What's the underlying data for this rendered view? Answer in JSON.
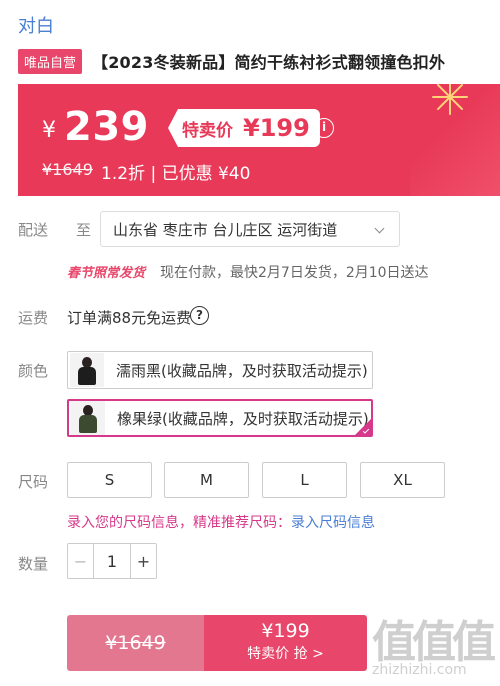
{
  "header": {
    "brand": "对白"
  },
  "product": {
    "badge": "唯品自营",
    "title": "【2023冬装新品】简约干练衬衫式翻领撞色扣外"
  },
  "price": {
    "currency": "¥",
    "main": "239",
    "flash_label": "特卖价",
    "flash_price": "¥199",
    "original": "¥1649",
    "discount_text": "1.2折 | 已优惠 ¥40",
    "colors": {
      "banner": "#e83a58",
      "accent": "#e8466a",
      "selected": "#d6398a",
      "link": "#4a7fd4"
    }
  },
  "delivery": {
    "label": "配送",
    "to": "至",
    "address": "山东省 枣庄市 台儿庄区 运河街道",
    "festival_badge": "春节照常发货",
    "schedule": "现在付款，最快2月7日发货，2月10日送达"
  },
  "freight": {
    "label": "运费",
    "text": "订单满88元免运费",
    "icon": "help-icon"
  },
  "color": {
    "label": "颜色",
    "options": [
      {
        "label": "濡雨黑(收藏品牌，及时获取活动提示)",
        "selected": false
      },
      {
        "label": "橡果绿(收藏品牌，及时获取活动提示)",
        "selected": true
      }
    ]
  },
  "size": {
    "label": "尺码",
    "options": [
      "S",
      "M",
      "L",
      "XL"
    ],
    "hint": "录入您的尺码信息，精准推荐尺码：",
    "hint_link": "录入尺码信息"
  },
  "quantity": {
    "label": "数量",
    "minus": "−",
    "value": "1",
    "plus": "+"
  },
  "buy": {
    "original": "¥1649",
    "price": "¥199",
    "label": "特卖价 抢 >"
  },
  "watermark": {
    "glyphs": "值值值",
    "url": "zhizhizhi.com"
  }
}
